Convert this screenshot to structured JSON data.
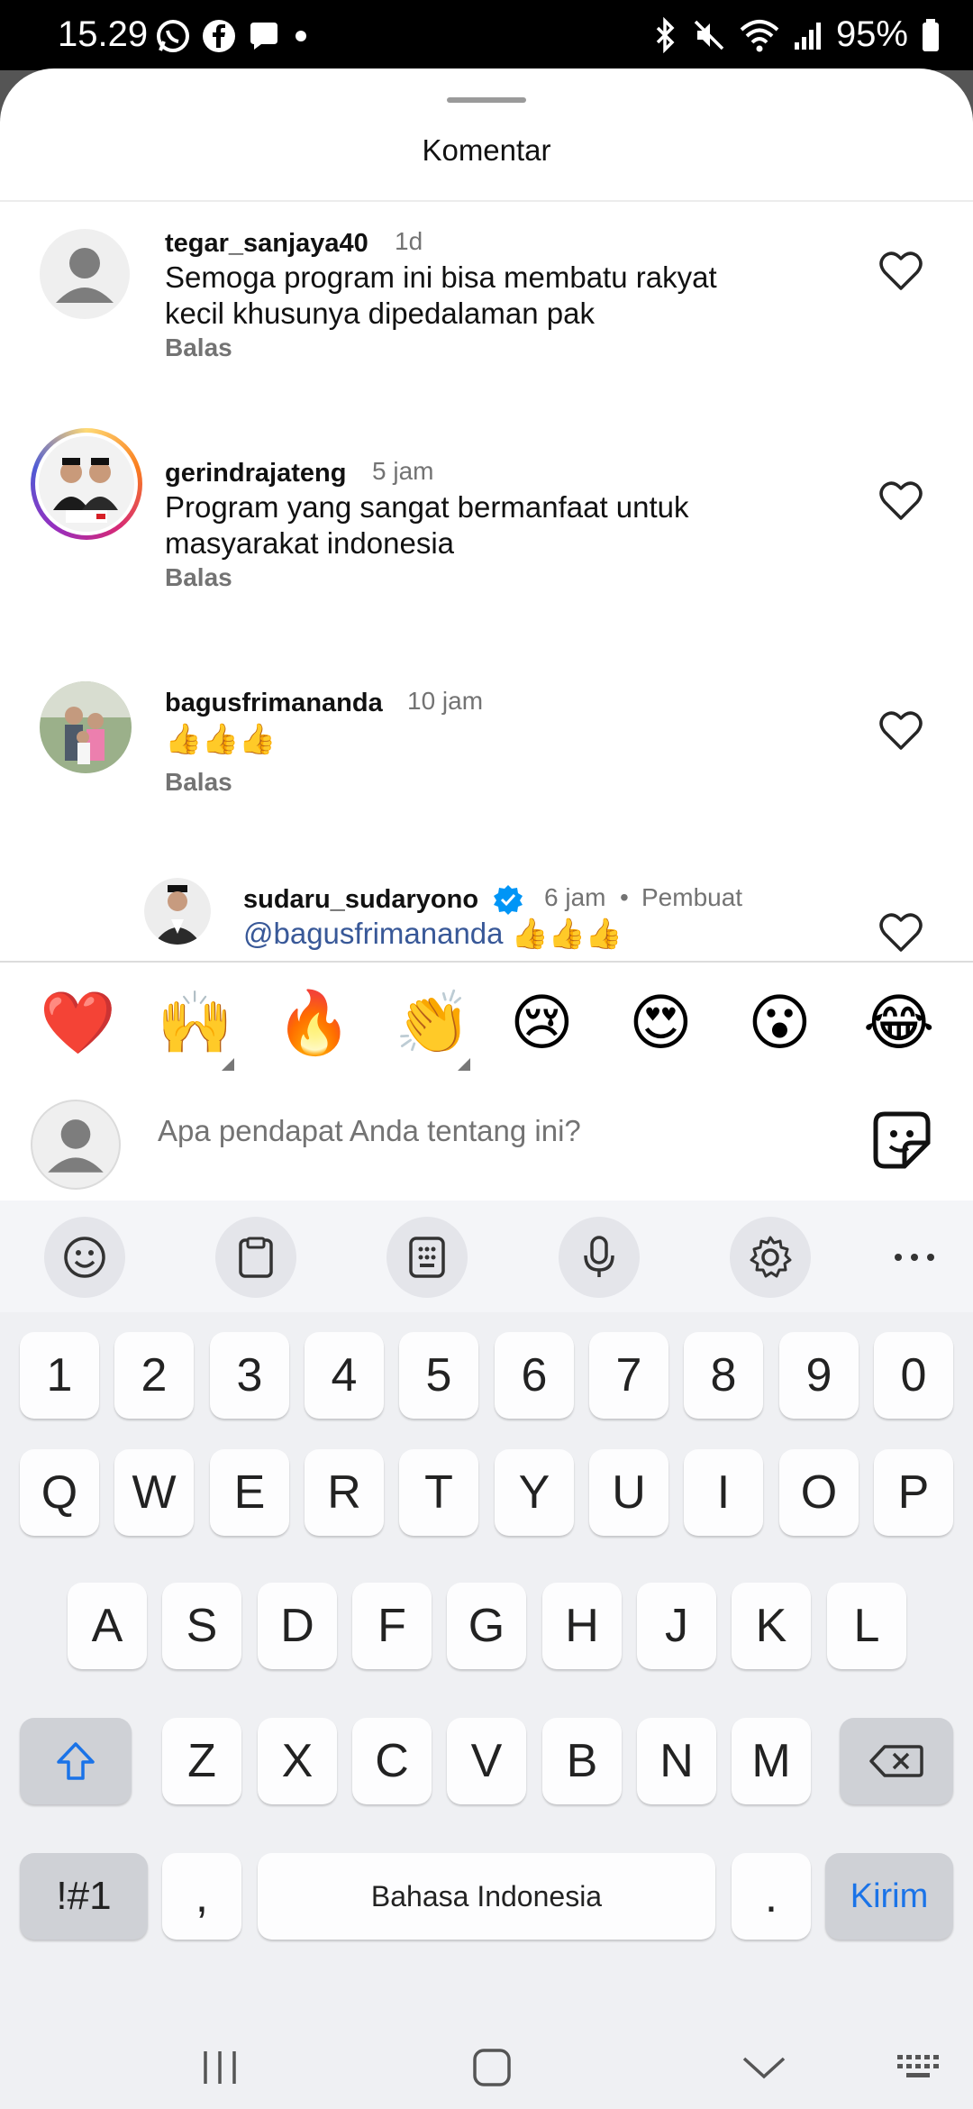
{
  "status_bar": {
    "time": "15.29",
    "battery": "95%",
    "left_icons": [
      "whatsapp-icon",
      "facebook-icon",
      "chat-bubble-icon",
      "dot-icon"
    ],
    "right_icons": [
      "bluetooth-icon",
      "mute-icon",
      "wifi-icon",
      "signal-icon",
      "battery-icon"
    ]
  },
  "sheet": {
    "title": "Komentar"
  },
  "comments": [
    {
      "username": "tegar_sanjaya40",
      "time": "1d",
      "lines": [
        "Semoga program ini bisa membatu rakyat",
        "kecil khusunya dipedalaman pak"
      ],
      "reply": "Balas",
      "avatar": "default-avatar"
    },
    {
      "username": "gerindrajateng",
      "time": "5 jam",
      "lines": [
        "Program yang sangat bermanfaat untuk",
        "masyarakat indonesia"
      ],
      "reply": "Balas",
      "avatar": "photo-avatar"
    },
    {
      "username": "bagusfrimananda",
      "time": "10 jam",
      "lines": [
        "👍👍👍"
      ],
      "reply": "Balas",
      "avatar": "photo-avatar"
    },
    {
      "username": "sudaru_sudaryono",
      "time": "6 jam",
      "author_tag": "Pembuat",
      "lines": [
        "@bagusfrimananda 👍👍👍"
      ],
      "mention": "@bagusfrimananda",
      "avatar": "photo-avatar",
      "verified": true
    }
  ],
  "reactions": [
    "❤️",
    "🙌",
    "🔥",
    "👏",
    "😢",
    "😍",
    "😮",
    "😂"
  ],
  "input": {
    "placeholder": "Apa pendapat Anda tentang ini?"
  },
  "keyboard": {
    "row_numbers": [
      "1",
      "2",
      "3",
      "4",
      "5",
      "6",
      "7",
      "8",
      "9",
      "0"
    ],
    "row_q": [
      "Q",
      "W",
      "E",
      "R",
      "T",
      "Y",
      "U",
      "I",
      "O",
      "P"
    ],
    "row_a": [
      "A",
      "S",
      "D",
      "F",
      "G",
      "H",
      "J",
      "K",
      "L"
    ],
    "row_z": [
      "Z",
      "X",
      "C",
      "V",
      "B",
      "N",
      "M"
    ],
    "symbols_label": "!#1",
    "comma": ",",
    "space_label": "Bahasa Indonesia",
    "period": ".",
    "enter_label": "Kirim"
  },
  "colors": {
    "accent": "#1a73e8",
    "secondary_text": "#737373",
    "heart": "#ff3040",
    "verified": "#0095f6"
  }
}
